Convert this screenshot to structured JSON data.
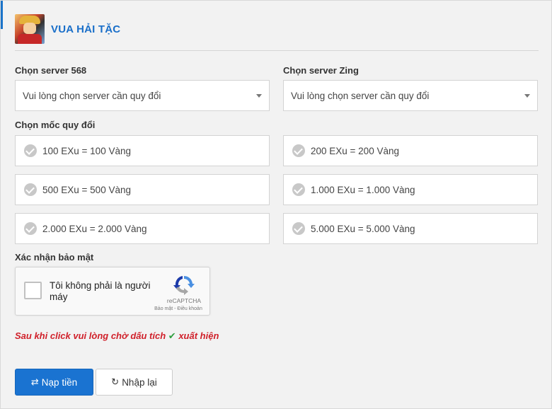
{
  "header": {
    "title": "VUA HẢI TẶC"
  },
  "servers": {
    "left_label": "Chọn server 568",
    "left_placeholder": "Vui lòng chọn server cần quy đổi",
    "right_label": "Chọn server Zing",
    "right_placeholder": "Vui lòng chọn server cần quy đổi"
  },
  "packages": {
    "label": "Chọn mốc quy đổi",
    "items": [
      "100 EXu = 100 Vàng",
      "200 EXu = 200 Vàng",
      "500 EXu = 500 Vàng",
      "1.000 EXu = 1.000 Vàng",
      "2.000 EXu = 2.000 Vàng",
      "5.000 EXu = 5.000 Vàng"
    ]
  },
  "security": {
    "label": "Xác nhận bảo mật",
    "captcha_text": "Tôi không phải là người máy",
    "captcha_brand": "reCAPTCHA",
    "captcha_links": "Bảo mật - Điều khoản"
  },
  "note": {
    "before": "Sau khi click vui lòng chờ dấu tích",
    "tick": "✔",
    "after": "xuất hiện"
  },
  "buttons": {
    "submit": "Nạp tiền",
    "reset": "Nhập lại"
  },
  "colors": {
    "accent": "#1a73d1",
    "warning": "#d0202a",
    "success": "#2e9e3e"
  }
}
